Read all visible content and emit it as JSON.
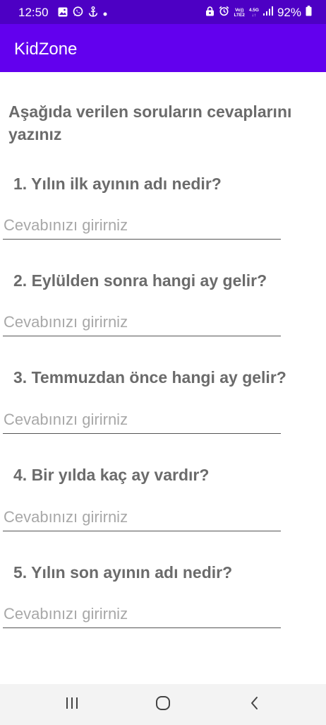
{
  "status_bar": {
    "time": "12:50",
    "network_top": "Vo))",
    "network_bottom": "LTE2",
    "data_top": "4.5G",
    "battery": "92%",
    "left_icons": [
      "image-icon",
      "whatsapp-icon",
      "anchor-icon",
      "dot-icon"
    ],
    "right_icons": [
      "lock-icon",
      "alarm-icon",
      "signal-icon",
      "battery-icon"
    ]
  },
  "app_bar": {
    "title": "KidZone"
  },
  "instructions": "Aşağıda verilen soruların cevaplarını yazınız",
  "questions": [
    {
      "text": "1. Yılın ilk ayının adı nedir?",
      "placeholder": "Cevabınızı girirniz",
      "value": ""
    },
    {
      "text": "2. Eylülden sonra hangi ay gelir?",
      "placeholder": "Cevabınızı girirniz",
      "value": ""
    },
    {
      "text": "3. Temmuzdan önce hangi ay gelir?",
      "placeholder": "Cevabınızı girirniz",
      "value": ""
    },
    {
      "text": "4. Bir yılda kaç ay vardır?",
      "placeholder": "Cevabınızı girirniz",
      "value": ""
    },
    {
      "text": "5. Yılın son ayının adı nedir?",
      "placeholder": "Cevabınızı girirniz",
      "value": ""
    }
  ],
  "nav_bar": {
    "buttons": [
      "recent-apps-icon",
      "home-icon",
      "back-icon"
    ]
  },
  "colors": {
    "app_bar": "#6200ee",
    "status_bar": "#4d00c4",
    "text": "#6b6b6b",
    "placeholder": "#a8a8a8"
  }
}
